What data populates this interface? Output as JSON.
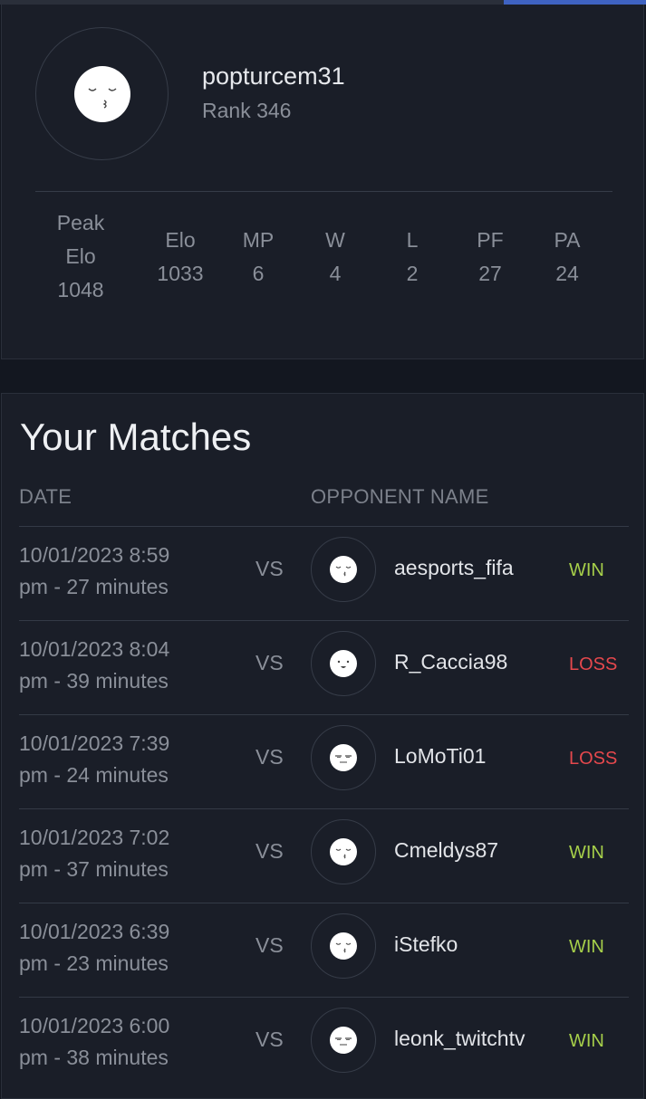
{
  "profile": {
    "username": "popturcem31",
    "rank": "Rank 346",
    "avatar_icon": "kiss-face-icon",
    "stats": [
      {
        "key": "peak_elo",
        "label": "Peak Elo",
        "value": "1048"
      },
      {
        "key": "elo",
        "label": "Elo",
        "value": "1033"
      },
      {
        "key": "mp",
        "label": "MP",
        "value": "6"
      },
      {
        "key": "w",
        "label": "W",
        "value": "4"
      },
      {
        "key": "l",
        "label": "L",
        "value": "2"
      },
      {
        "key": "pf",
        "label": "PF",
        "value": "27"
      },
      {
        "key": "pa",
        "label": "PA",
        "value": "24"
      }
    ]
  },
  "matches": {
    "title": "Your Matches",
    "headers": {
      "date": "DATE",
      "opponent": "OPPONENT NAME"
    },
    "vs_label": "VS",
    "rows": [
      {
        "date_line1": "10/01/2023 8:59",
        "date_line2": "pm - 27 minutes",
        "opponent": "aesports_fifa",
        "result": "WIN",
        "avatar_icon": "kiss-face-icon"
      },
      {
        "date_line1": "10/01/2023 8:04",
        "date_line2": "pm - 39 minutes",
        "opponent": "R_Caccia98",
        "result": "LOSS",
        "avatar_icon": "smile-face-icon"
      },
      {
        "date_line1": "10/01/2023 7:39",
        "date_line2": "pm - 24 minutes",
        "opponent": "LoMoTi01",
        "result": "LOSS",
        "avatar_icon": "unamused-face-icon"
      },
      {
        "date_line1": "10/01/2023 7:02",
        "date_line2": "pm - 37 minutes",
        "opponent": "Cmeldys87",
        "result": "WIN",
        "avatar_icon": "kiss-face-icon"
      },
      {
        "date_line1": "10/01/2023 6:39",
        "date_line2": "pm - 23 minutes",
        "opponent": "iStefko",
        "result": "WIN",
        "avatar_icon": "kiss-face-icon"
      },
      {
        "date_line1": "10/01/2023 6:00",
        "date_line2": "pm - 38 minutes",
        "opponent": "leonk_twitchtv",
        "result": "WIN",
        "avatar_icon": "unamused-face-icon"
      }
    ]
  },
  "colors": {
    "background": "#131720",
    "card": "#1a1e28",
    "win": "#a6cf4a",
    "loss": "#e5484d",
    "accent": "#3f63c2"
  }
}
